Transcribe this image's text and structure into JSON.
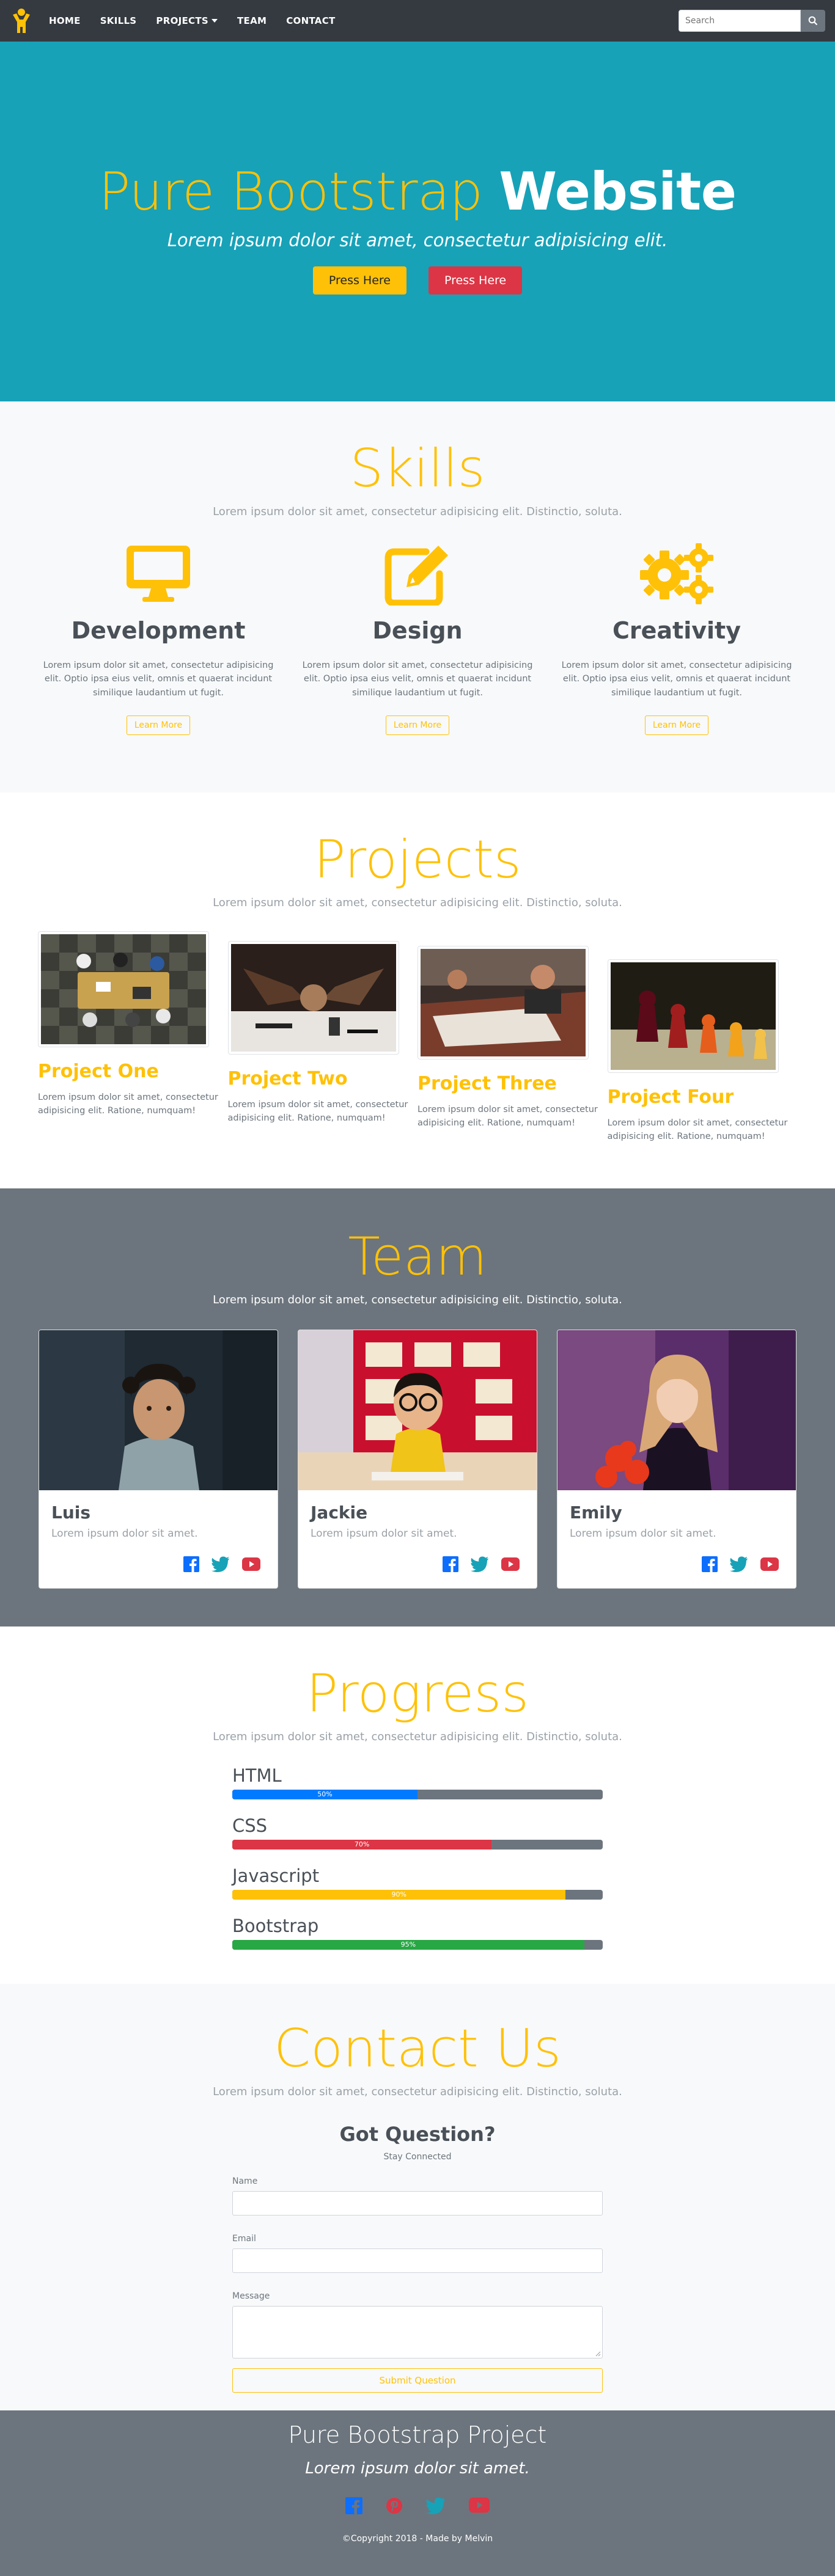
{
  "navbar": {
    "logo_icon": "person-logo-icon",
    "items": [
      {
        "label": "HOME"
      },
      {
        "label": "SKILLS"
      },
      {
        "label": "PROJECTS"
      },
      {
        "label": "TEAM"
      },
      {
        "label": "CONTACT"
      }
    ],
    "search_placeholder": "Search",
    "search_icon": "search-icon"
  },
  "hero": {
    "title_light": "Pure Bootstrap",
    "title_bold": "Website",
    "subtitle": "Lorem ipsum dolor sit amet, consectetur adipisicing elit.",
    "button1": "Press Here",
    "button2": "Press Here"
  },
  "skills": {
    "title": "Skills",
    "subtitle": "Lorem ipsum dolor sit amet, consectetur adipisicing elit. Distinctio, soluta.",
    "items": [
      {
        "icon": "desktop-icon",
        "name": "Development",
        "text": "Lorem ipsum dolor sit amet, consectetur adipisicing elit. Optio ipsa eius velit, omnis et quaerat incidunt similique laudantium ut fugit.",
        "button": "Learn More"
      },
      {
        "icon": "edit-icon",
        "name": "Design",
        "text": "Lorem ipsum dolor sit amet, consectetur adipisicing elit. Optio ipsa eius velit, omnis et quaerat incidunt similique laudantium ut fugit.",
        "button": "Learn More"
      },
      {
        "icon": "cogs-icon",
        "name": "Creativity",
        "text": "Lorem ipsum dolor sit amet, consectetur adipisicing elit. Optio ipsa eius velit, omnis et quaerat incidunt similique laudantium ut fugit.",
        "button": "Learn More"
      }
    ]
  },
  "projects": {
    "title": "Projects",
    "subtitle": "Lorem ipsum dolor sit amet, consectetur adipisicing elit. Distinctio, soluta.",
    "items": [
      {
        "name": "Project One",
        "text": "Lorem ipsum dolor sit amet, consectetur adipisicing elit. Ratione, numquam!"
      },
      {
        "name": "Project Two",
        "text": "Lorem ipsum dolor sit amet, consectetur adipisicing elit. Ratione, numquam!"
      },
      {
        "name": "Project Three",
        "text": "Lorem ipsum dolor sit amet, consectetur adipisicing elit. Ratione, numquam!"
      },
      {
        "name": "Project Four",
        "text": "Lorem ipsum dolor sit amet, consectetur adipisicing elit. Ratione, numquam!"
      }
    ]
  },
  "team": {
    "title": "Team",
    "subtitle": "Lorem ipsum dolor sit amet, consectetur adipisicing elit. Distinctio, soluta.",
    "members": [
      {
        "name": "Luis",
        "text": "Lorem ipsum dolor sit amet."
      },
      {
        "name": "Jackie",
        "text": "Lorem ipsum dolor sit amet."
      },
      {
        "name": "Emily",
        "text": "Lorem ipsum dolor sit amet."
      }
    ],
    "social_icons": [
      "facebook-icon",
      "twitter-icon",
      "youtube-icon"
    ]
  },
  "progress": {
    "title": "Progress",
    "subtitle": "Lorem ipsum dolor sit amet, consectetur adipisicing elit. Distinctio, soluta.",
    "bars": [
      {
        "label": "HTML",
        "value": 50,
        "text": "50%",
        "color": "#007bff"
      },
      {
        "label": "CSS",
        "value": 70,
        "text": "70%",
        "color": "#dc3545"
      },
      {
        "label": "Javascript",
        "value": 90,
        "text": "90%",
        "color": "#ffc107"
      },
      {
        "label": "Bootstrap",
        "value": 95,
        "text": "95%",
        "color": "#28a745"
      }
    ]
  },
  "contact": {
    "title": "Contact Us",
    "subtitle": "Lorem ipsum dolor sit amet, consectetur adipisicing elit. Distinctio, soluta.",
    "heading": "Got Question?",
    "small": "Stay Connected",
    "name_label": "Name",
    "email_label": "Email",
    "message_label": "Message",
    "submit": "Submit Question"
  },
  "footer": {
    "title": "Pure Bootstrap Project",
    "subtitle": "Lorem ipsum dolor sit amet.",
    "social_icons": [
      "facebook-icon",
      "pinterest-icon",
      "twitter-icon",
      "youtube-icon"
    ],
    "copyright": "©Copyright 2018 - Made by Melvin"
  },
  "colors": {
    "accent": "#ffc107",
    "hero_bg": "#17a2b8",
    "dark": "#343a40",
    "gray": "#6c757d"
  }
}
